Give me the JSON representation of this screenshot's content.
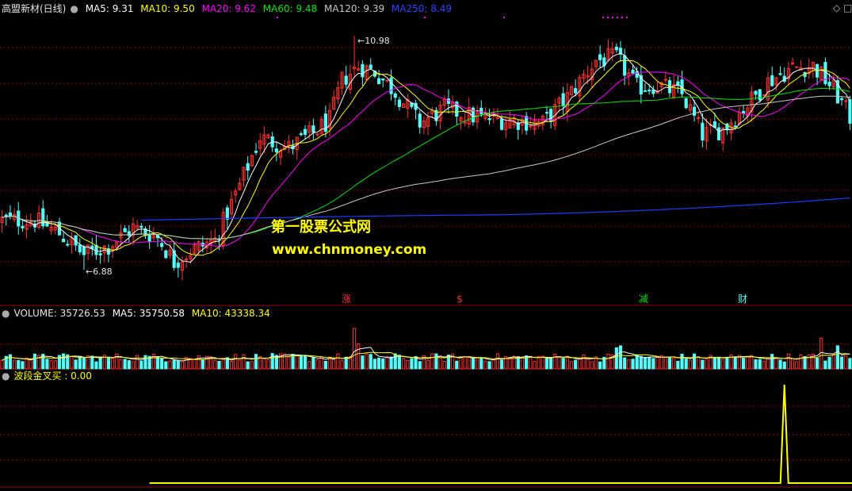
{
  "colors": {
    "bg": "#000000",
    "grid": "#8b0000",
    "up": "#ff3232",
    "down": "#54fcfc",
    "ma5": "#ffffff",
    "ma10": "#ffff00",
    "ma20": "#ff00ff",
    "ma60": "#00e600",
    "ma120": "#c8c8c8",
    "ma250": "#1c3cff",
    "signal": "#ffff00",
    "watermark": "#ffff00",
    "event_up": "#ff3232",
    "event_green": "#00e600",
    "event_cyan": "#54fcfc"
  },
  "main_header": {
    "stock": "高盟新材(日线)",
    "ma5": "MA5: 9.31",
    "ma10": "MA10: 9.50",
    "ma20": "MA20: 9.62",
    "ma60": "MA60: 9.48",
    "ma120": "MA120: 9.39",
    "ma250": "MA250: 8.49"
  },
  "volume_header": {
    "title": "VOLUME: 35726.53",
    "ma5": "MA5: 35750.58",
    "ma10": "MA10: 43338.34"
  },
  "indicator_header": {
    "title": "波段金叉买 : 0.00"
  },
  "price_annotations": {
    "high": "10.98",
    "low": "6.88"
  },
  "event_markers": [
    "涨",
    "$",
    "减",
    "财"
  ],
  "watermark": {
    "line1": "第一股票公式网",
    "line2": "www.chnmoney.com"
  },
  "window_controls": {
    "diamond": "◇",
    "box": "□"
  },
  "chart_data": {
    "type": "candlestick",
    "price_range": [
      6.3,
      11.3
    ],
    "bar_count": 208,
    "anchors": [
      [
        0,
        7.75
      ],
      [
        8,
        7.75
      ],
      [
        14,
        7.52
      ],
      [
        20,
        7.15
      ],
      [
        26,
        7.3
      ],
      [
        32,
        7.62
      ],
      [
        38,
        7.45
      ],
      [
        42,
        7.02
      ],
      [
        47,
        7.25
      ],
      [
        52,
        7.4
      ],
      [
        57,
        8.2
      ],
      [
        63,
        9.2
      ],
      [
        70,
        9.02
      ],
      [
        76,
        9.28
      ],
      [
        80,
        9.5
      ],
      [
        83,
        10.2
      ],
      [
        87,
        10.45
      ],
      [
        91,
        10.35
      ],
      [
        96,
        10.0
      ],
      [
        102,
        9.45
      ],
      [
        108,
        9.7
      ],
      [
        116,
        9.55
      ],
      [
        124,
        9.5
      ],
      [
        132,
        9.45
      ],
      [
        138,
        9.9
      ],
      [
        145,
        10.55
      ],
      [
        150,
        10.6
      ],
      [
        155,
        10.08
      ],
      [
        160,
        10.12
      ],
      [
        166,
        9.95
      ],
      [
        171,
        9.25
      ],
      [
        176,
        9.35
      ],
      [
        182,
        9.78
      ],
      [
        187,
        10.18
      ],
      [
        193,
        10.42
      ],
      [
        198,
        10.45
      ],
      [
        203,
        10.05
      ],
      [
        207,
        9.55
      ]
    ],
    "overlay_high": {
      "bar": 86,
      "price": 10.98
    },
    "overlay_low": {
      "bar": 20,
      "price": 6.88
    },
    "moving_averages": [
      "MA5",
      "MA10",
      "MA20",
      "MA60",
      "MA120",
      "MA250"
    ],
    "volume_range": [
      0,
      130000
    ],
    "volume_spikes": [
      [
        86,
        105000
      ],
      [
        87,
        65000
      ],
      [
        150,
        55000
      ],
      [
        151,
        60000
      ],
      [
        200,
        80000
      ],
      [
        204,
        60000
      ]
    ],
    "signal_value": 0.0,
    "signal_spike": {
      "bar": 191,
      "value": 1.0
    }
  }
}
